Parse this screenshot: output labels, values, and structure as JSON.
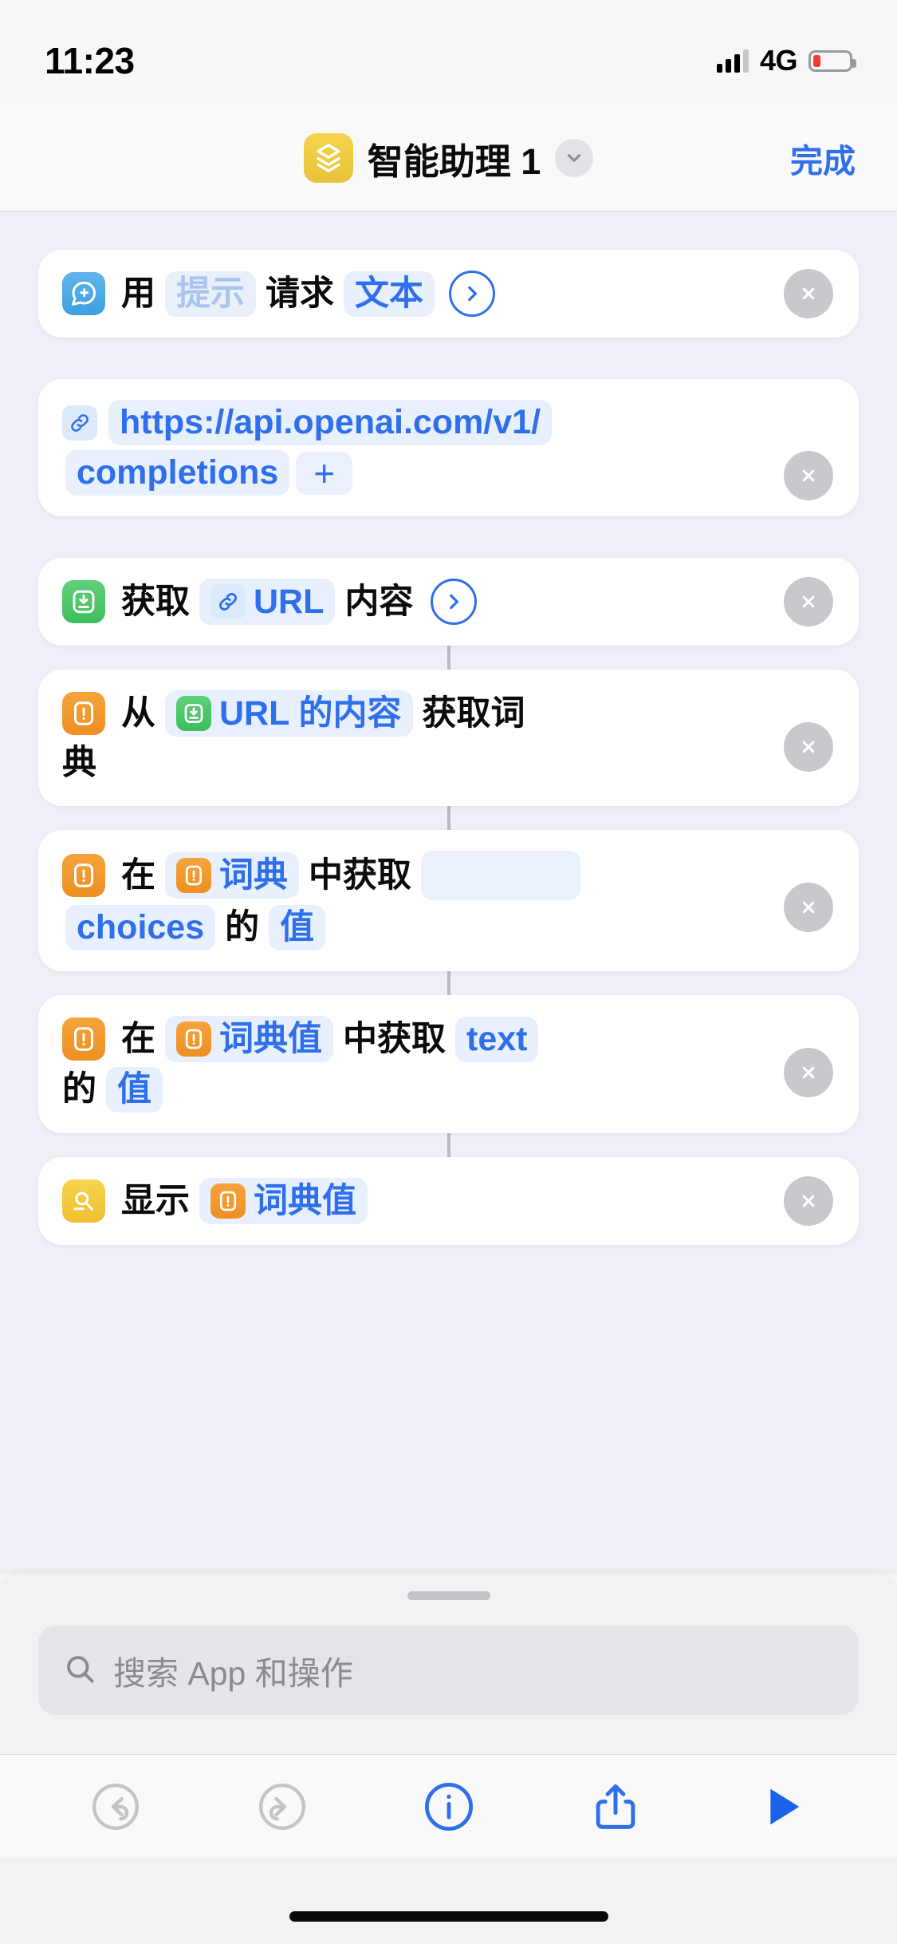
{
  "status_bar": {
    "time": "11:23",
    "network": "4G",
    "signal_icon": "signal-bars-icon",
    "battery_icon": "battery-low-icon"
  },
  "nav_bar": {
    "app_icon": "shortcuts-icon",
    "title": "智能助理 1",
    "chevron_icon": "chevron-down-icon",
    "done_label": "完成"
  },
  "actions": [
    {
      "icon": "chat-plus-icon",
      "lines": [
        [
          {
            "type": "text",
            "value": "用"
          },
          {
            "type": "placeholder",
            "value": "提示"
          },
          {
            "type": "text",
            "value": "请求"
          },
          {
            "type": "token",
            "value": "文本"
          },
          {
            "type": "chevron",
            "value": "chevron-right-icon"
          }
        ]
      ]
    },
    {
      "icon": "link-icon",
      "lines": [
        [
          {
            "type": "icon-chip",
            "value": "link-icon"
          },
          {
            "type": "token",
            "value": "https://api.openai.com/v1/"
          }
        ],
        [
          {
            "type": "token",
            "value": "completions"
          },
          {
            "type": "plus",
            "value": "+"
          }
        ]
      ]
    },
    {
      "icon": "download-url-icon",
      "lines": [
        [
          {
            "type": "text",
            "value": "获取"
          },
          {
            "type": "token-with-icon",
            "icon": "link-icon",
            "value": "URL"
          },
          {
            "type": "text",
            "value": "内容"
          },
          {
            "type": "chevron",
            "value": "chevron-right-icon"
          }
        ]
      ]
    },
    {
      "icon": "dictionary-icon",
      "lines": [
        [
          {
            "type": "text",
            "value": "从"
          },
          {
            "type": "token-with-icon",
            "icon": "download-url-icon",
            "value": "URL 的内容"
          },
          {
            "type": "text",
            "value": "获取词"
          }
        ],
        [
          {
            "type": "text",
            "value": "典"
          }
        ]
      ]
    },
    {
      "icon": "dictionary-icon",
      "lines": [
        [
          {
            "type": "text",
            "value": "在"
          },
          {
            "type": "token-with-icon",
            "icon": "dictionary-icon",
            "value": "词典"
          },
          {
            "type": "text",
            "value": "中获取"
          },
          {
            "type": "blank",
            "value": ""
          }
        ],
        [
          {
            "type": "token",
            "value": "choices"
          },
          {
            "type": "text",
            "value": "的"
          },
          {
            "type": "token",
            "value": "值"
          }
        ]
      ]
    },
    {
      "icon": "dictionary-icon",
      "lines": [
        [
          {
            "type": "text",
            "value": "在"
          },
          {
            "type": "token-with-icon",
            "icon": "dictionary-icon",
            "value": "词典值"
          },
          {
            "type": "text",
            "value": "中获取"
          },
          {
            "type": "token",
            "value": "text"
          }
        ],
        [
          {
            "type": "text",
            "value": "的"
          },
          {
            "type": "token",
            "value": "值"
          }
        ]
      ]
    },
    {
      "icon": "quicklook-icon",
      "lines": [
        [
          {
            "type": "text",
            "value": "显示"
          },
          {
            "type": "token-with-icon",
            "icon": "dictionary-icon",
            "value": "词典值"
          }
        ]
      ]
    }
  ],
  "card_1": {
    "t1": "用",
    "ph": "提示",
    "t2": "请求",
    "tok": "文本"
  },
  "card_2": {
    "url_line1": "https://api.openai.com/v1/",
    "url_line2": "completions",
    "plus": "+"
  },
  "card_3": {
    "t1": "获取",
    "tok": "URL",
    "t2": "内容"
  },
  "card_4": {
    "t1": "从",
    "tok": "URL 的内容",
    "t2": "获取词",
    "t3": "典"
  },
  "card_5": {
    "t1": "在",
    "tok1": "词典",
    "t2": "中获取",
    "tok2": "choices",
    "t3": "的",
    "tok3": "值"
  },
  "card_6": {
    "t1": "在",
    "tok1": "词典值",
    "t2": "中获取",
    "tok2": "text",
    "t3": "的",
    "tok3": "值"
  },
  "card_7": {
    "t1": "显示",
    "tok": "词典值"
  },
  "remove_label": "×",
  "sheet": {
    "search_placeholder": "搜索 App 和操作",
    "search_icon": "search-icon",
    "grabber": "sheet-grabber"
  },
  "toolbar": {
    "undo_icon": "undo-icon",
    "redo_icon": "redo-icon",
    "info_icon": "info-icon",
    "share_icon": "share-icon",
    "play_icon": "play-icon"
  },
  "colors": {
    "accent_blue": "#2F6FEB",
    "token_bg": "#E8F0FD",
    "canvas": "#EFEFF7",
    "card": "#FFFFFF",
    "icon_blue": "#3E9FE0",
    "icon_green": "#3DBD5B",
    "icon_orange": "#EE8F22",
    "icon_yellow": "#EFC02F",
    "battery_red": "#F23A30"
  }
}
